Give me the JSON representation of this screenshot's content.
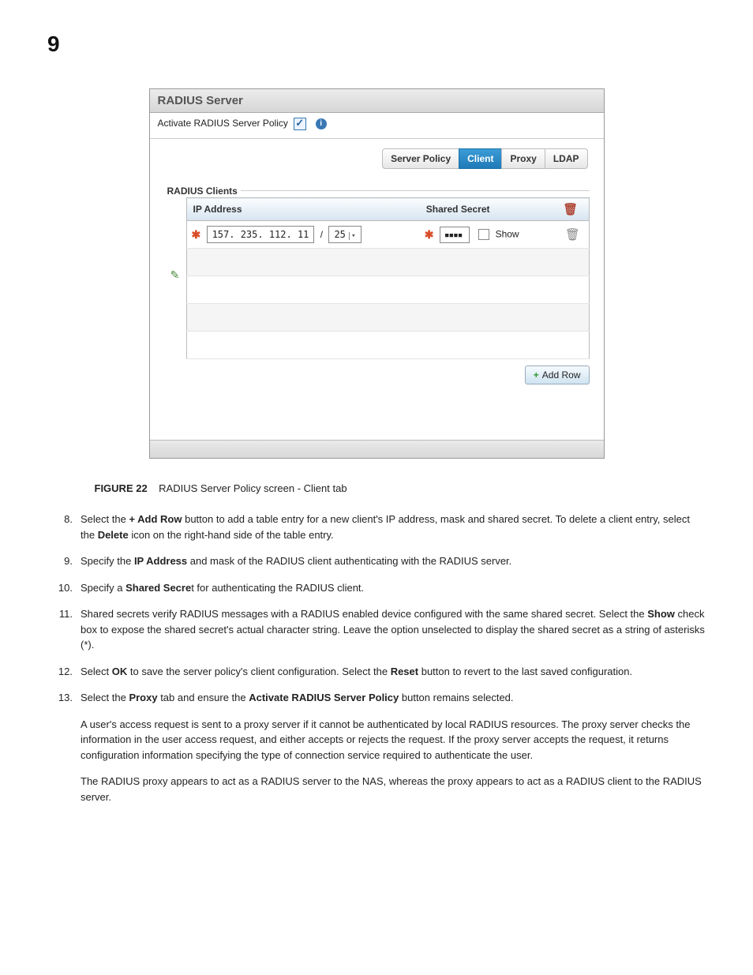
{
  "pageNumber": "9",
  "panel": {
    "title": "RADIUS Server",
    "activateLabel": "Activate RADIUS Server Policy",
    "tabs": {
      "serverPolicy": "Server Policy",
      "client": "Client",
      "proxy": "Proxy",
      "ldap": "LDAP"
    },
    "fieldsetLegend": "RADIUS Clients",
    "headers": {
      "ip": "IP Address",
      "secret": "Shared Secret"
    },
    "row": {
      "ip": "157. 235. 112.  11",
      "mask": "25",
      "secret": "▪▪▪▪",
      "showLabel": "Show"
    },
    "addRow": "Add Row"
  },
  "caption": {
    "prefix": "FIGURE 22",
    "text": "RADIUS Server Policy screen - Client tab"
  },
  "steps": {
    "s8": {
      "num": "8.",
      "a": "Select the ",
      "b": "+ Add Row",
      "c": " button to add a table entry for a new client's IP address, mask and shared secret. To delete a client entry, select the ",
      "d": "Delete",
      "e": " icon on the right-hand side of the table entry."
    },
    "s9": {
      "num": "9.",
      "a": "Specify the ",
      "b": "IP Address",
      "c": " and mask of the RADIUS client authenticating with the RADIUS server."
    },
    "s10": {
      "num": "10.",
      "a": "Specify a ",
      "b": "Shared Secre",
      "c": "t for authenticating the RADIUS client."
    },
    "s11": {
      "num": "11.",
      "a": "Shared secrets verify RADIUS messages with a RADIUS enabled device configured with the same shared secret. Select the ",
      "b": "Show",
      "c": " check box to expose the shared secret's actual character string. Leave the option unselected to display the shared secret as a string of asterisks (*)."
    },
    "s12": {
      "num": "12.",
      "a": "Select ",
      "b": "OK",
      "c": " to save the server policy's client configuration. Select the ",
      "d": "Reset",
      "e": " button to revert to the last saved configuration."
    },
    "s13": {
      "num": "13.",
      "a": "Select the ",
      "b": "Proxy",
      "c": " tab and ensure the ",
      "d": "Activate RADIUS Server Policy",
      "e": " button remains selected.",
      "p1": "A user's access request is sent to a proxy server if it cannot be authenticated by local RADIUS resources. The proxy server checks the information in the user access request, and either accepts or rejects the request. If the proxy server accepts the request, it returns configuration information specifying the type of connection service required to authenticate the user.",
      "p2": "The RADIUS proxy appears to act as a RADIUS server to the NAS, whereas the proxy appears to act as a RADIUS client to the RADIUS server."
    }
  }
}
